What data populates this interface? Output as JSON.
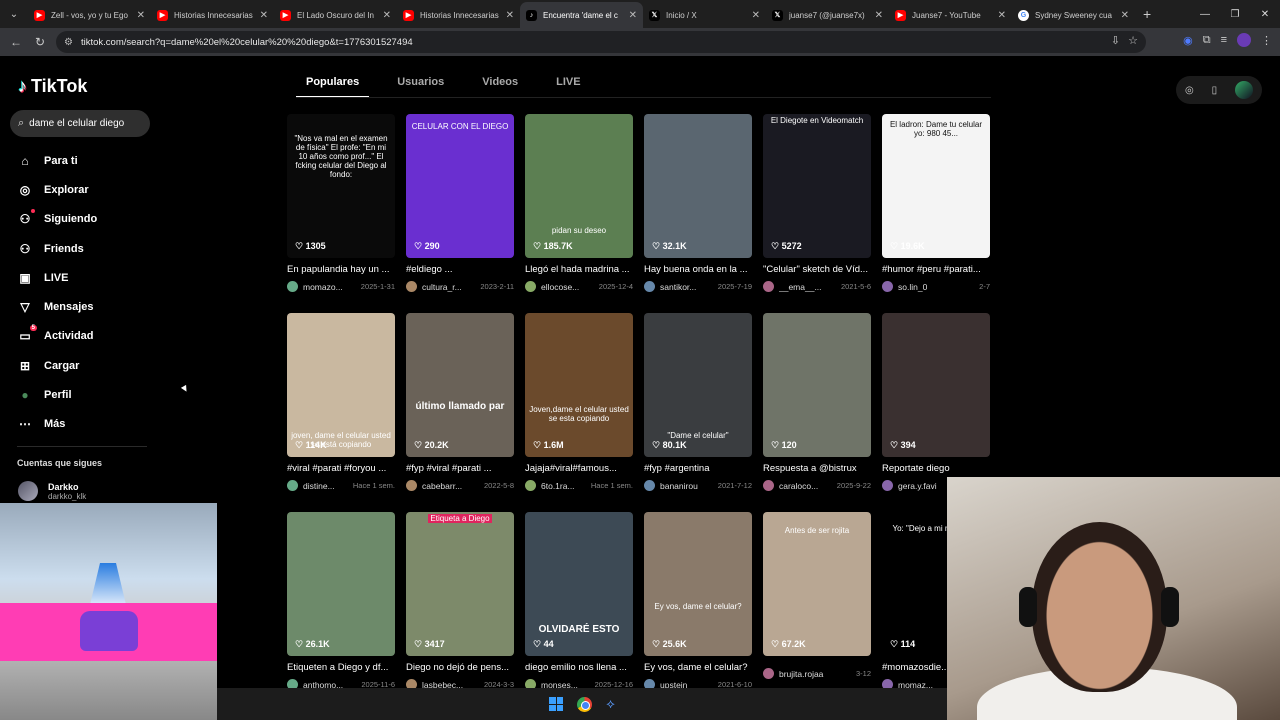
{
  "browser": {
    "tabs": [
      {
        "title": "Zell - vos, yo y tu Ego",
        "fav": "youtube-icon",
        "color": "#ff0000"
      },
      {
        "title": "Historias Innecesarias",
        "fav": "youtube-icon",
        "color": "#ff0000"
      },
      {
        "title": "El Lado Oscuro del In",
        "fav": "youtube-icon",
        "color": "#ff0000"
      },
      {
        "title": "Historias Innecesarias",
        "fav": "youtube-icon",
        "color": "#ff0000"
      },
      {
        "title": "Encuentra 'dame el c",
        "fav": "tiktok-icon",
        "color": "#000000",
        "active": true
      },
      {
        "title": "Inicio / X",
        "fav": "x-icon",
        "color": "#000000"
      },
      {
        "title": "juanse7 (@juanse7x)",
        "fav": "x-icon",
        "color": "#000000"
      },
      {
        "title": "Juanse7 - YouTube",
        "fav": "youtube-icon",
        "color": "#ff0000"
      },
      {
        "title": "Sydney Sweeney cua",
        "fav": "google-icon",
        "color": "#ffffff"
      }
    ],
    "url": "tiktok.com/search?q=dame%20el%20celular%20%20diego&t=1776301527494"
  },
  "app": {
    "logo": "TikTok",
    "search_value": "dame el celular diego"
  },
  "nav": [
    {
      "label": "Para ti",
      "icon": "home-icon"
    },
    {
      "label": "Explorar",
      "icon": "compass-icon"
    },
    {
      "label": "Siguiendo",
      "icon": "following-icon"
    },
    {
      "label": "Friends",
      "icon": "friends-icon"
    },
    {
      "label": "LIVE",
      "icon": "live-icon"
    },
    {
      "label": "Mensajes",
      "icon": "messages-icon"
    },
    {
      "label": "Actividad",
      "icon": "activity-icon",
      "badge": "5"
    },
    {
      "label": "Cargar",
      "icon": "upload-icon"
    },
    {
      "label": "Perfil",
      "icon": "profile-icon"
    },
    {
      "label": "Más",
      "icon": "more-icon"
    }
  ],
  "following": {
    "title": "Cuentas que sigues",
    "accounts": [
      {
        "name": "Darkko",
        "handle": "darkko_klk"
      }
    ]
  },
  "content_tabs": [
    "Populares",
    "Usuarios",
    "Videos",
    "LIVE"
  ],
  "videos": [
    {
      "likes": "1305",
      "caption": "En papulandia hay un ...",
      "user": "momazo...",
      "date": "2025-1-31",
      "overlay": "\"Nos va mal en el examen de física\" El profe: \"En mi 10 años como prof...\" El fcking celular del Diego al fondo:",
      "bg": "#0a0a0a"
    },
    {
      "likes": "290",
      "caption": "#eldiego ...",
      "user": "cultura_r...",
      "date": "2023-2-11",
      "overlay": "CELULAR CON EL DIEGO",
      "bg": "#6a2fd0"
    },
    {
      "likes": "185.7K",
      "caption": "Llegó el hada madrina ...",
      "user": "ellocose...",
      "date": "2025-12-4",
      "overlay": "pidan su deseo",
      "bg": "#5c7f52"
    },
    {
      "likes": "32.1K",
      "caption": "Hay buena onda en la ...",
      "user": "santikor...",
      "date": "2025-7-19",
      "overlay": "",
      "bg": "#5a6670"
    },
    {
      "likes": "5272",
      "caption": "\"Celular\" sketch de Víd...",
      "user": "__ema__...",
      "date": "2021-5-6",
      "overlay": "El Diegote en Videomatch",
      "bg": "#1a1a22"
    },
    {
      "likes": "19.6K",
      "caption": "#humor #peru #parati...",
      "user": "so.lin_0",
      "date": "2-7",
      "overlay": "El ladron: Dame tu celular yo: 980 45...",
      "bg": "#f4f4f4"
    },
    {
      "likes": "114K",
      "caption": "#viral #parati #foryou ...",
      "user": "distine...",
      "date": "Hace 1 sem.",
      "overlay": "joven, dame el celular usted se está copiando",
      "bg": "#c9b8a0"
    },
    {
      "likes": "20.2K",
      "caption": "#fyp #viral #parati ...",
      "user": "cabebarr...",
      "date": "2022-5-8",
      "overlay": "último llamado par",
      "bg": "#6a6258"
    },
    {
      "likes": "1.6M",
      "caption": "Jajaja#viral#famous...",
      "user": "6to.1ra...",
      "date": "Hace 1 sem.",
      "overlay": "Joven,dame el celular usted se esta copiando",
      "bg": "#6b4a2c"
    },
    {
      "likes": "80.1K",
      "caption": "#fyp #argentina",
      "user": "bananirou",
      "date": "2021-7-12",
      "overlay": "\"Dame el celular\"",
      "bg": "#3a3d40"
    },
    {
      "likes": "120",
      "caption": "Respuesta a @bistrux",
      "user": "caraloco...",
      "date": "2025-9-22",
      "overlay": "",
      "bg": "#6f7468"
    },
    {
      "likes": "394",
      "caption": "Reportate diego",
      "user": "gera.y.favi",
      "date": "",
      "overlay": "",
      "bg": "#3a3030"
    },
    {
      "likes": "26.1K",
      "caption": "Etiqueten a Diego y df...",
      "user": "anthomo...",
      "date": "2025-11-6",
      "overlay": "",
      "bg": "#6d8a6a"
    },
    {
      "likes": "3417",
      "caption": "Diego no dejó de pens...",
      "user": "lasbebec...",
      "date": "2024-3-3",
      "overlay": "Etiqueta a Diego",
      "bg": "#7d8a6a"
    },
    {
      "likes": "44",
      "caption": "diego emilio nos llena ...",
      "user": "monses...",
      "date": "2025-12-16",
      "overlay": "OLVIDARÉ ESTO",
      "bg": "#3d4a55"
    },
    {
      "likes": "25.6K",
      "caption": "Ey vos, dame el celular?",
      "user": "upstein",
      "date": "2021-6-10",
      "overlay": "Ey vos, dame el celular?",
      "bg": "#8a7a6a"
    },
    {
      "likes": "67.2K",
      "caption": "",
      "user": "brujita.rojaa",
      "date": "3-12",
      "overlay": "Antes de ser rojita",
      "bg": "#b9a793"
    },
    {
      "likes": "114",
      "caption": "#momazosdie...",
      "user": "momaz...",
      "date": "",
      "overlay": "Yo: \"Dejo a mi mamá sin",
      "bg": "#000000"
    }
  ]
}
